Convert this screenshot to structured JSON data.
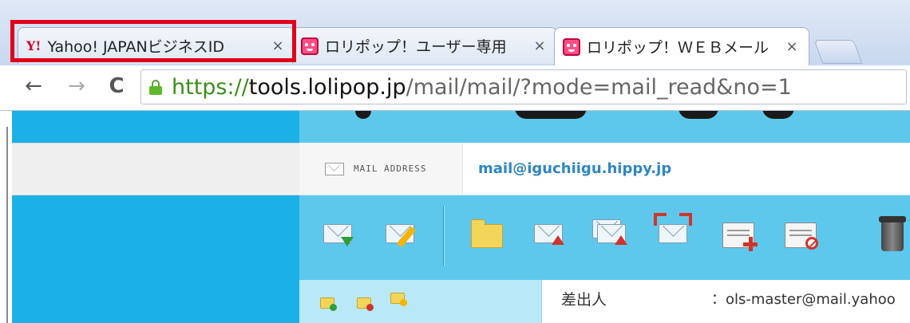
{
  "browser": {
    "tabs": [
      {
        "title": "Yahoo! JAPANビジネスID",
        "favicon": "yahoo-y-icon",
        "close": "×",
        "active": false
      },
      {
        "title": "ロリポップ！ユーザー専用",
        "favicon": "lolipop-icon",
        "close": "×",
        "active": false
      },
      {
        "title": "ロリポップ！ＷＥＢメール",
        "favicon": "lolipop-icon",
        "close": "×",
        "active": true
      }
    ],
    "yahoo_favicon_text": "Y!",
    "nav": {
      "back": "←",
      "forward": "→",
      "reload": "C"
    },
    "url": {
      "scheme": "https://",
      "host": "tools.lolipop.jp",
      "path": "/mail/mail/?mode=mail_read&no=1"
    },
    "highlight_color": "#e0001a"
  },
  "mail": {
    "address_label": "MAIL ADDRESS",
    "address_value": "mail@iguchiigu.hippy.jp",
    "toolbar_icons": [
      "receive-mail-icon",
      "compose-mail-icon",
      "new-folder-icon",
      "send-mail-icon",
      "send-multiple-mail-icon",
      "forward-mail-icon",
      "add-address-icon",
      "block-address-icon",
      "trash-icon"
    ],
    "folder_icons": [
      "add-folder-icon",
      "delete-folder-icon",
      "edit-folder-icon"
    ],
    "sender_label": "差出人",
    "sender_value": "：ols-master@mail.yahoo"
  },
  "colors": {
    "accent_blue": "#1bb0e6",
    "header_blue": "#5ec8ec",
    "link_blue": "#2e86c1",
    "secure_green": "#3b8d1a"
  }
}
